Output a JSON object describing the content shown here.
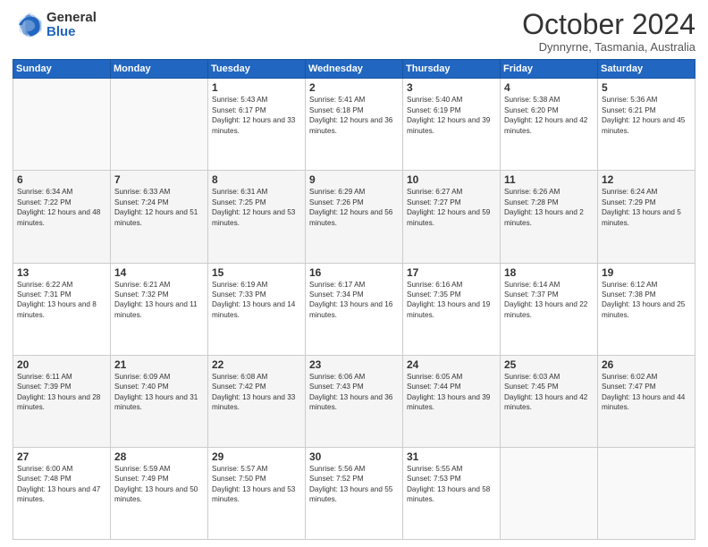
{
  "header": {
    "logo_general": "General",
    "logo_blue": "Blue",
    "month_title": "October 2024",
    "subtitle": "Dynnyrne, Tasmania, Australia"
  },
  "weekdays": [
    "Sunday",
    "Monday",
    "Tuesday",
    "Wednesday",
    "Thursday",
    "Friday",
    "Saturday"
  ],
  "weeks": [
    [
      {
        "day": "",
        "sunrise": "",
        "sunset": "",
        "daylight": ""
      },
      {
        "day": "",
        "sunrise": "",
        "sunset": "",
        "daylight": ""
      },
      {
        "day": "1",
        "sunrise": "Sunrise: 5:43 AM",
        "sunset": "Sunset: 6:17 PM",
        "daylight": "Daylight: 12 hours and 33 minutes."
      },
      {
        "day": "2",
        "sunrise": "Sunrise: 5:41 AM",
        "sunset": "Sunset: 6:18 PM",
        "daylight": "Daylight: 12 hours and 36 minutes."
      },
      {
        "day": "3",
        "sunrise": "Sunrise: 5:40 AM",
        "sunset": "Sunset: 6:19 PM",
        "daylight": "Daylight: 12 hours and 39 minutes."
      },
      {
        "day": "4",
        "sunrise": "Sunrise: 5:38 AM",
        "sunset": "Sunset: 6:20 PM",
        "daylight": "Daylight: 12 hours and 42 minutes."
      },
      {
        "day": "5",
        "sunrise": "Sunrise: 5:36 AM",
        "sunset": "Sunset: 6:21 PM",
        "daylight": "Daylight: 12 hours and 45 minutes."
      }
    ],
    [
      {
        "day": "6",
        "sunrise": "Sunrise: 6:34 AM",
        "sunset": "Sunset: 7:22 PM",
        "daylight": "Daylight: 12 hours and 48 minutes."
      },
      {
        "day": "7",
        "sunrise": "Sunrise: 6:33 AM",
        "sunset": "Sunset: 7:24 PM",
        "daylight": "Daylight: 12 hours and 51 minutes."
      },
      {
        "day": "8",
        "sunrise": "Sunrise: 6:31 AM",
        "sunset": "Sunset: 7:25 PM",
        "daylight": "Daylight: 12 hours and 53 minutes."
      },
      {
        "day": "9",
        "sunrise": "Sunrise: 6:29 AM",
        "sunset": "Sunset: 7:26 PM",
        "daylight": "Daylight: 12 hours and 56 minutes."
      },
      {
        "day": "10",
        "sunrise": "Sunrise: 6:27 AM",
        "sunset": "Sunset: 7:27 PM",
        "daylight": "Daylight: 12 hours and 59 minutes."
      },
      {
        "day": "11",
        "sunrise": "Sunrise: 6:26 AM",
        "sunset": "Sunset: 7:28 PM",
        "daylight": "Daylight: 13 hours and 2 minutes."
      },
      {
        "day": "12",
        "sunrise": "Sunrise: 6:24 AM",
        "sunset": "Sunset: 7:29 PM",
        "daylight": "Daylight: 13 hours and 5 minutes."
      }
    ],
    [
      {
        "day": "13",
        "sunrise": "Sunrise: 6:22 AM",
        "sunset": "Sunset: 7:31 PM",
        "daylight": "Daylight: 13 hours and 8 minutes."
      },
      {
        "day": "14",
        "sunrise": "Sunrise: 6:21 AM",
        "sunset": "Sunset: 7:32 PM",
        "daylight": "Daylight: 13 hours and 11 minutes."
      },
      {
        "day": "15",
        "sunrise": "Sunrise: 6:19 AM",
        "sunset": "Sunset: 7:33 PM",
        "daylight": "Daylight: 13 hours and 14 minutes."
      },
      {
        "day": "16",
        "sunrise": "Sunrise: 6:17 AM",
        "sunset": "Sunset: 7:34 PM",
        "daylight": "Daylight: 13 hours and 16 minutes."
      },
      {
        "day": "17",
        "sunrise": "Sunrise: 6:16 AM",
        "sunset": "Sunset: 7:35 PM",
        "daylight": "Daylight: 13 hours and 19 minutes."
      },
      {
        "day": "18",
        "sunrise": "Sunrise: 6:14 AM",
        "sunset": "Sunset: 7:37 PM",
        "daylight": "Daylight: 13 hours and 22 minutes."
      },
      {
        "day": "19",
        "sunrise": "Sunrise: 6:12 AM",
        "sunset": "Sunset: 7:38 PM",
        "daylight": "Daylight: 13 hours and 25 minutes."
      }
    ],
    [
      {
        "day": "20",
        "sunrise": "Sunrise: 6:11 AM",
        "sunset": "Sunset: 7:39 PM",
        "daylight": "Daylight: 13 hours and 28 minutes."
      },
      {
        "day": "21",
        "sunrise": "Sunrise: 6:09 AM",
        "sunset": "Sunset: 7:40 PM",
        "daylight": "Daylight: 13 hours and 31 minutes."
      },
      {
        "day": "22",
        "sunrise": "Sunrise: 6:08 AM",
        "sunset": "Sunset: 7:42 PM",
        "daylight": "Daylight: 13 hours and 33 minutes."
      },
      {
        "day": "23",
        "sunrise": "Sunrise: 6:06 AM",
        "sunset": "Sunset: 7:43 PM",
        "daylight": "Daylight: 13 hours and 36 minutes."
      },
      {
        "day": "24",
        "sunrise": "Sunrise: 6:05 AM",
        "sunset": "Sunset: 7:44 PM",
        "daylight": "Daylight: 13 hours and 39 minutes."
      },
      {
        "day": "25",
        "sunrise": "Sunrise: 6:03 AM",
        "sunset": "Sunset: 7:45 PM",
        "daylight": "Daylight: 13 hours and 42 minutes."
      },
      {
        "day": "26",
        "sunrise": "Sunrise: 6:02 AM",
        "sunset": "Sunset: 7:47 PM",
        "daylight": "Daylight: 13 hours and 44 minutes."
      }
    ],
    [
      {
        "day": "27",
        "sunrise": "Sunrise: 6:00 AM",
        "sunset": "Sunset: 7:48 PM",
        "daylight": "Daylight: 13 hours and 47 minutes."
      },
      {
        "day": "28",
        "sunrise": "Sunrise: 5:59 AM",
        "sunset": "Sunset: 7:49 PM",
        "daylight": "Daylight: 13 hours and 50 minutes."
      },
      {
        "day": "29",
        "sunrise": "Sunrise: 5:57 AM",
        "sunset": "Sunset: 7:50 PM",
        "daylight": "Daylight: 13 hours and 53 minutes."
      },
      {
        "day": "30",
        "sunrise": "Sunrise: 5:56 AM",
        "sunset": "Sunset: 7:52 PM",
        "daylight": "Daylight: 13 hours and 55 minutes."
      },
      {
        "day": "31",
        "sunrise": "Sunrise: 5:55 AM",
        "sunset": "Sunset: 7:53 PM",
        "daylight": "Daylight: 13 hours and 58 minutes."
      },
      {
        "day": "",
        "sunrise": "",
        "sunset": "",
        "daylight": ""
      },
      {
        "day": "",
        "sunrise": "",
        "sunset": "",
        "daylight": ""
      }
    ]
  ]
}
